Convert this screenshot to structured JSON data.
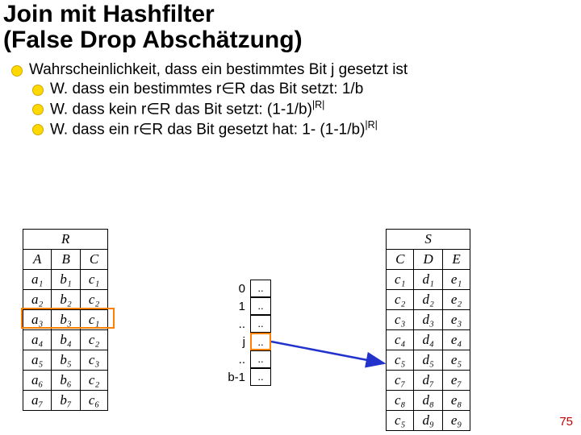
{
  "title_line1": "Join mit Hashfilter",
  "title_line2": "(False Drop Abschätzung)",
  "bullets": {
    "main": "Wahrscheinlichkeit, dass ein bestimmtes Bit j gesetzt ist",
    "sub1_pre": "W. dass ein bestimmtes r",
    "sub1_mid": "R das Bit setzt: 1/b",
    "sub2_pre": "W. dass kein r",
    "sub2_mid": "R das Bit setzt: (1-1/b)",
    "sub2_sup": "|R|",
    "sub3_pre": "W. dass ein r",
    "sub3_mid": "R das Bit gesetzt hat: 1- (1-1/b)",
    "sub3_sup": "|R|",
    "elem": "∈"
  },
  "table_r": {
    "name": "R",
    "cols": [
      "A",
      "B",
      "C"
    ],
    "rows": [
      [
        "a₁",
        "b₁",
        "c₁"
      ],
      [
        "a₂",
        "b₂",
        "c₂"
      ],
      [
        "a₃",
        "b₃",
        "c₁"
      ],
      [
        "a₄",
        "b₄",
        "c₂"
      ],
      [
        "a₅",
        "b₅",
        "c₃"
      ],
      [
        "a₆",
        "b₆",
        "c₂"
      ],
      [
        "a₇",
        "b₇",
        "c₆"
      ]
    ]
  },
  "table_s": {
    "name": "S",
    "cols": [
      "C",
      "D",
      "E"
    ],
    "rows": [
      [
        "c₁",
        "d₁",
        "e₁"
      ],
      [
        "c₂",
        "d₂",
        "e₂"
      ],
      [
        "c₃",
        "d₃",
        "e₃"
      ],
      [
        "c₄",
        "d₄",
        "e₄"
      ],
      [
        "c₅",
        "d₅",
        "e₅"
      ],
      [
        "c₇",
        "d₇",
        "e₇"
      ],
      [
        "c₈",
        "d₈",
        "e₈"
      ],
      [
        "c₅",
        "d₉",
        "e₉"
      ]
    ]
  },
  "bitvector": {
    "labels": [
      "0",
      "1",
      "..",
      "j",
      "..",
      "b-1"
    ],
    "cells": [
      "..",
      "..",
      "..",
      "..",
      "..",
      ".."
    ]
  },
  "page_number": "75"
}
